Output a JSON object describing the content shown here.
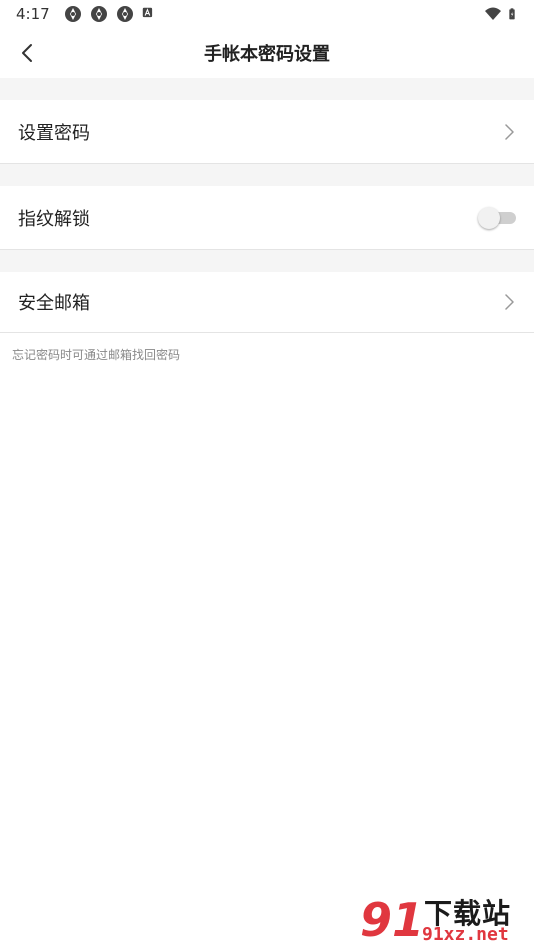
{
  "status_bar": {
    "time": "4:17",
    "left_icons": [
      "sync-icon",
      "sync-icon",
      "sync-icon",
      "a-icon"
    ],
    "right_icons": [
      "wifi-icon",
      "battery-icon"
    ]
  },
  "nav": {
    "title": "手帐本密码设置",
    "back_icon": "chevron-left-icon"
  },
  "settings": [
    {
      "label": "设置密码",
      "control": "chevron"
    },
    {
      "label": "指纹解锁",
      "control": "toggle",
      "enabled": false
    },
    {
      "label": "安全邮箱",
      "control": "chevron"
    }
  ],
  "hint": "忘记密码时可通过邮箱找回密码",
  "watermark": {
    "badge": "91",
    "title": "下载站",
    "domain": "91xz.net"
  },
  "colors": {
    "background": "#ffffff",
    "section_gap": "#f5f5f5",
    "divider": "#e4e4e4",
    "toggle_track_off": "#cfcfcf",
    "watermark_accent": "#e0373f"
  }
}
